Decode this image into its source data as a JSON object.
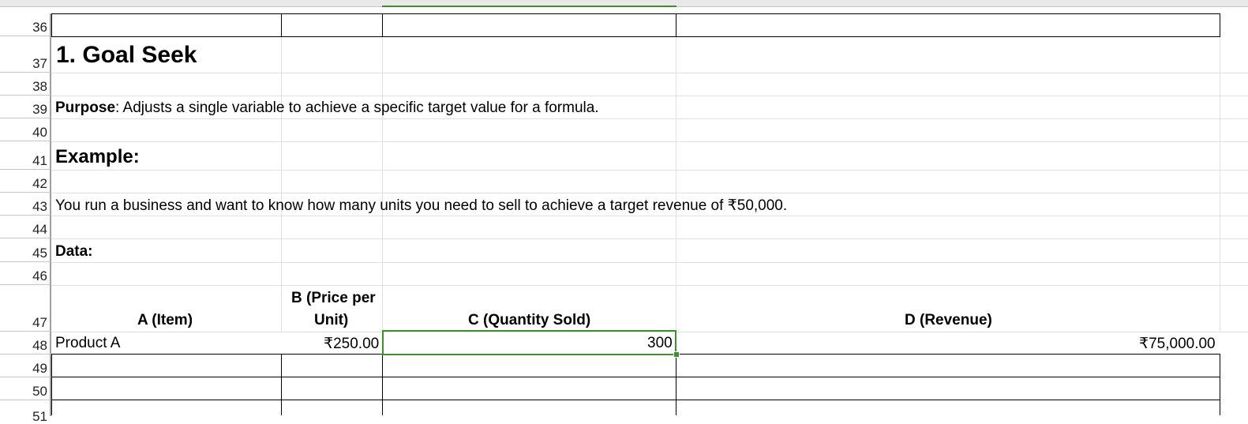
{
  "row_numbers": [
    "36",
    "37",
    "38",
    "39",
    "40",
    "41",
    "42",
    "43",
    "44",
    "45",
    "46",
    "47",
    "48",
    "49",
    "50",
    "51"
  ],
  "title": "1. Goal Seek",
  "purpose_label": "Purpose",
  "purpose_text": ": Adjusts a single variable to achieve a specific target value for a formula.",
  "example_heading": "Example:",
  "scenario_text": "You run a business and want to know how many units you need to sell to achieve a target revenue of ₹50,000.",
  "data_heading": "Data:",
  "table": {
    "headers": [
      "A (Item)",
      "B (Price per",
      "Unit)",
      "C (Quantity Sold)",
      "D (Revenue)"
    ],
    "row": {
      "item": "Product A",
      "price": "₹250.00",
      "quantity": "300",
      "revenue": "₹75,000.00"
    }
  },
  "colors": {
    "selection": "#3f8f2f",
    "gridline": "#e1e1e1",
    "border": "#000000"
  }
}
